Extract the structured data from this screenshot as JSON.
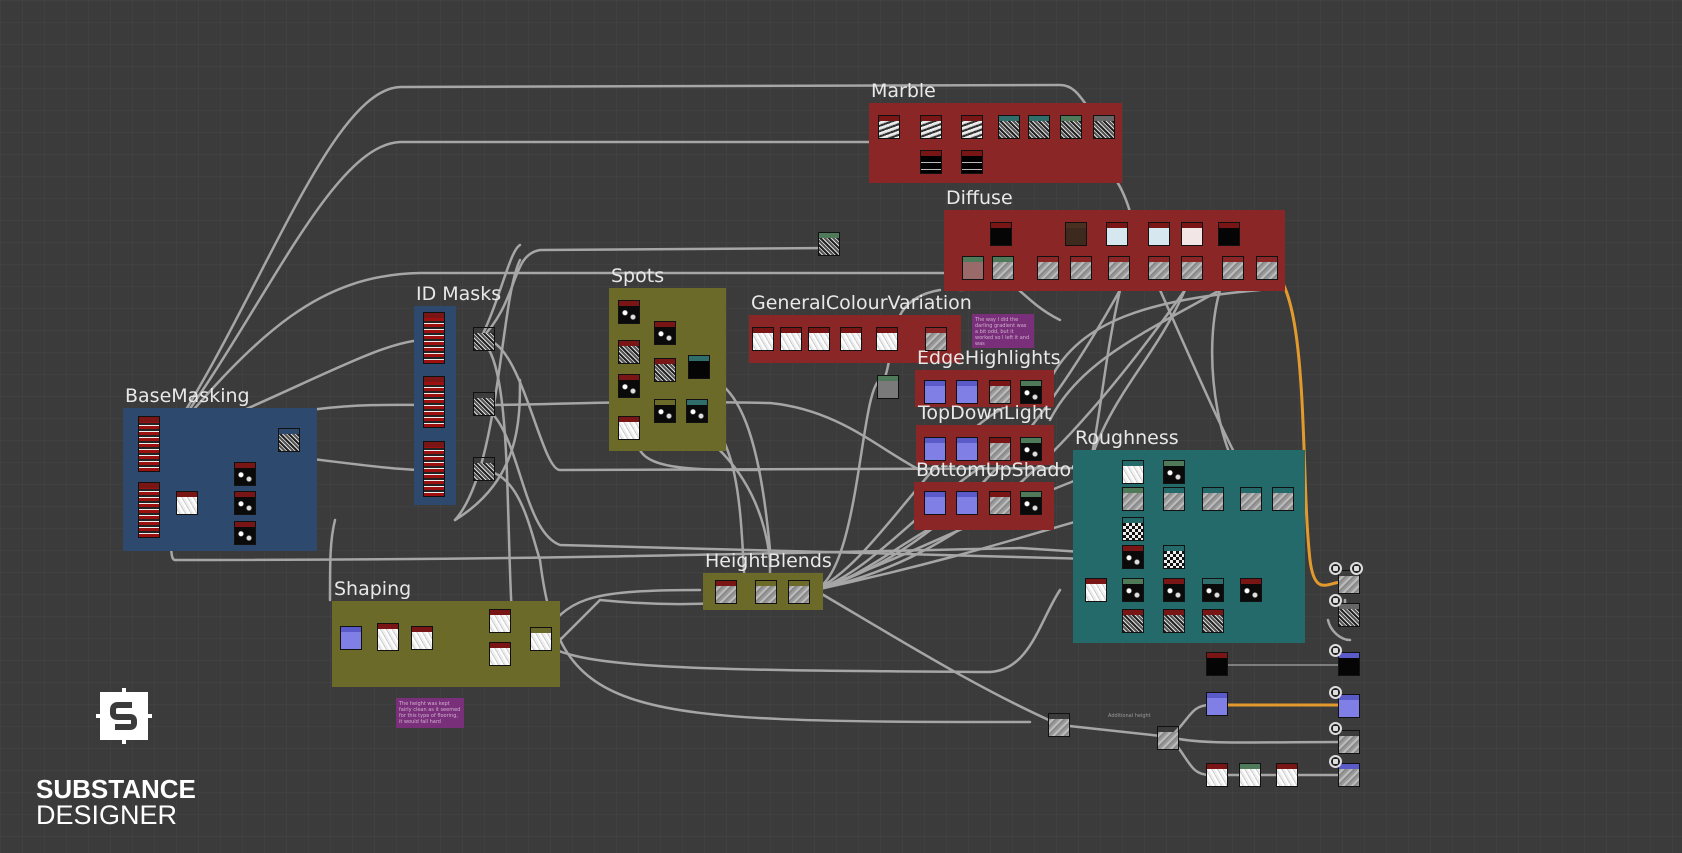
{
  "app": {
    "name": "Substance Designer"
  },
  "logo": {
    "line1": "SUBSTANCE",
    "line2": "DESIGNER"
  },
  "colors": {
    "background": "#3b3b3b",
    "wire": "#a6a6a6",
    "wire_highlight": "#e39a2d",
    "frame_blue": "#2d4a6e",
    "frame_red": "#8a2626",
    "frame_olive": "#6b6a28",
    "frame_teal": "#256a6a",
    "comment_purple": "#7a2f7a"
  },
  "frames": {
    "marble": "Marble",
    "diffuse": "Diffuse",
    "id_masks": "ID Masks",
    "spots": "Spots",
    "general_colour_variation": "GeneralColourVariation",
    "edge_highlights": "EdgeHighlights",
    "top_down_light": "TopDownLight",
    "bottom_up_shadow": "BottomUpShadow",
    "roughness": "Roughness",
    "base_masking": "BaseMasking",
    "height_blends": "HeightBlends",
    "shaping": "Shaping"
  },
  "comments": {
    "colour_note": "The way I did the darling gradient was a bit odd, but it worked so I left it and was",
    "shaping_note": "The height was kept fairly clean as it seemed for this type of flooring, it would fall hard",
    "additional_height": "Additional height"
  },
  "output_node_icons": [
    "output-icon",
    "output-icon",
    "output-icon",
    "output-icon",
    "output-icon",
    "output-icon",
    "output-icon",
    "output-icon"
  ]
}
